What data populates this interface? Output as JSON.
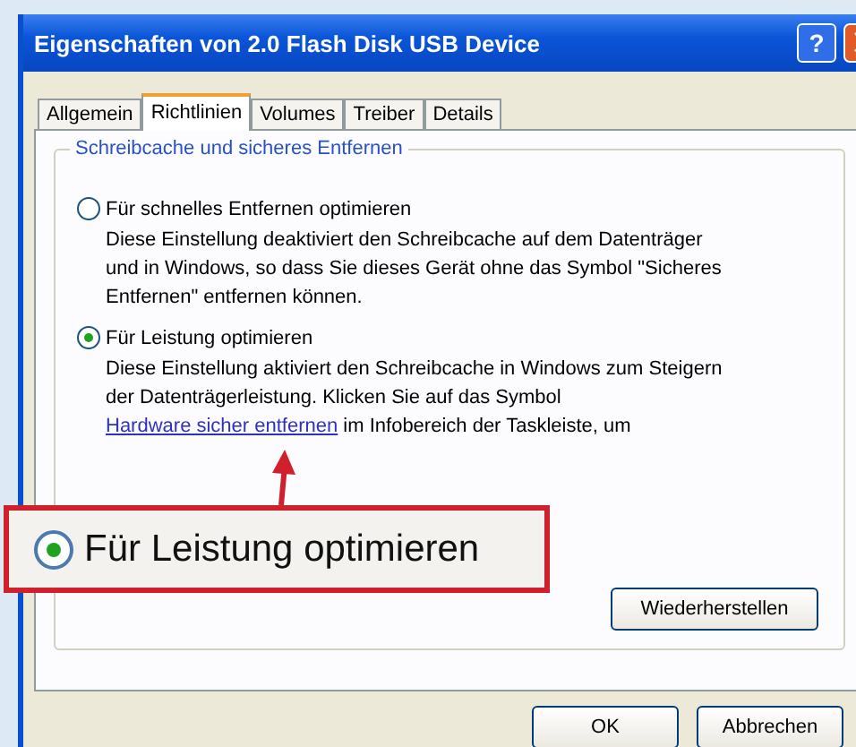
{
  "window": {
    "title": "Eigenschaften von 2.0 Flash Disk USB Device",
    "help_button": "?"
  },
  "tabs": [
    {
      "label": "Allgemein",
      "selected": false
    },
    {
      "label": "Richtlinien",
      "selected": true
    },
    {
      "label": "Volumes",
      "selected": false
    },
    {
      "label": "Treiber",
      "selected": false
    },
    {
      "label": "Details",
      "selected": false
    }
  ],
  "group": {
    "title": "Schreibcache und sicheres Entfernen",
    "options": [
      {
        "label": "Für schnelles Entfernen optimieren",
        "selected": false,
        "description": "Diese Einstellung deaktiviert den Schreibcache auf dem Datenträger und in Windows, so dass Sie dieses Gerät ohne das Symbol \"Sicheres Entfernen\" entfernen können."
      },
      {
        "label": "Für Leistung optimieren",
        "selected": true,
        "description": "Diese Einstellung aktiviert den Schreibcache in Windows zum Steigern der Datenträgerleistung. Klicken Sie auf das Symbol",
        "link": "Hardware sicher entfernen",
        "description_after": " im Infobereich der Taskleiste, um"
      }
    ],
    "restore_button": "Wiederherstellen"
  },
  "buttons": [
    "OK",
    "Abbrechen"
  ],
  "callout": {
    "label": "Für Leistung optimieren",
    "selected": true
  }
}
